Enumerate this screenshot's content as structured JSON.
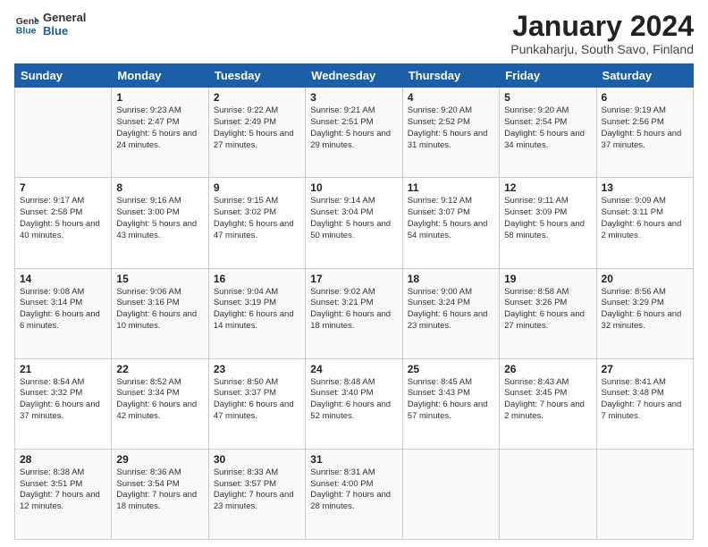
{
  "logo": {
    "line1": "General",
    "line2": "Blue"
  },
  "title": "January 2024",
  "subtitle": "Punkaharju, South Savo, Finland",
  "weekdays": [
    "Sunday",
    "Monday",
    "Tuesday",
    "Wednesday",
    "Thursday",
    "Friday",
    "Saturday"
  ],
  "weeks": [
    [
      {
        "day": "",
        "sunrise": "",
        "sunset": "",
        "daylight": ""
      },
      {
        "day": "1",
        "sunrise": "Sunrise: 9:23 AM",
        "sunset": "Sunset: 2:47 PM",
        "daylight": "Daylight: 5 hours and 24 minutes."
      },
      {
        "day": "2",
        "sunrise": "Sunrise: 9:22 AM",
        "sunset": "Sunset: 2:49 PM",
        "daylight": "Daylight: 5 hours and 27 minutes."
      },
      {
        "day": "3",
        "sunrise": "Sunrise: 9:21 AM",
        "sunset": "Sunset: 2:51 PM",
        "daylight": "Daylight: 5 hours and 29 minutes."
      },
      {
        "day": "4",
        "sunrise": "Sunrise: 9:20 AM",
        "sunset": "Sunset: 2:52 PM",
        "daylight": "Daylight: 5 hours and 31 minutes."
      },
      {
        "day": "5",
        "sunrise": "Sunrise: 9:20 AM",
        "sunset": "Sunset: 2:54 PM",
        "daylight": "Daylight: 5 hours and 34 minutes."
      },
      {
        "day": "6",
        "sunrise": "Sunrise: 9:19 AM",
        "sunset": "Sunset: 2:56 PM",
        "daylight": "Daylight: 5 hours and 37 minutes."
      }
    ],
    [
      {
        "day": "7",
        "sunrise": "Sunrise: 9:17 AM",
        "sunset": "Sunset: 2:58 PM",
        "daylight": "Daylight: 5 hours and 40 minutes."
      },
      {
        "day": "8",
        "sunrise": "Sunrise: 9:16 AM",
        "sunset": "Sunset: 3:00 PM",
        "daylight": "Daylight: 5 hours and 43 minutes."
      },
      {
        "day": "9",
        "sunrise": "Sunrise: 9:15 AM",
        "sunset": "Sunset: 3:02 PM",
        "daylight": "Daylight: 5 hours and 47 minutes."
      },
      {
        "day": "10",
        "sunrise": "Sunrise: 9:14 AM",
        "sunset": "Sunset: 3:04 PM",
        "daylight": "Daylight: 5 hours and 50 minutes."
      },
      {
        "day": "11",
        "sunrise": "Sunrise: 9:12 AM",
        "sunset": "Sunset: 3:07 PM",
        "daylight": "Daylight: 5 hours and 54 minutes."
      },
      {
        "day": "12",
        "sunrise": "Sunrise: 9:11 AM",
        "sunset": "Sunset: 3:09 PM",
        "daylight": "Daylight: 5 hours and 58 minutes."
      },
      {
        "day": "13",
        "sunrise": "Sunrise: 9:09 AM",
        "sunset": "Sunset: 3:11 PM",
        "daylight": "Daylight: 6 hours and 2 minutes."
      }
    ],
    [
      {
        "day": "14",
        "sunrise": "Sunrise: 9:08 AM",
        "sunset": "Sunset: 3:14 PM",
        "daylight": "Daylight: 6 hours and 6 minutes."
      },
      {
        "day": "15",
        "sunrise": "Sunrise: 9:06 AM",
        "sunset": "Sunset: 3:16 PM",
        "daylight": "Daylight: 6 hours and 10 minutes."
      },
      {
        "day": "16",
        "sunrise": "Sunrise: 9:04 AM",
        "sunset": "Sunset: 3:19 PM",
        "daylight": "Daylight: 6 hours and 14 minutes."
      },
      {
        "day": "17",
        "sunrise": "Sunrise: 9:02 AM",
        "sunset": "Sunset: 3:21 PM",
        "daylight": "Daylight: 6 hours and 18 minutes."
      },
      {
        "day": "18",
        "sunrise": "Sunrise: 9:00 AM",
        "sunset": "Sunset: 3:24 PM",
        "daylight": "Daylight: 6 hours and 23 minutes."
      },
      {
        "day": "19",
        "sunrise": "Sunrise: 8:58 AM",
        "sunset": "Sunset: 3:26 PM",
        "daylight": "Daylight: 6 hours and 27 minutes."
      },
      {
        "day": "20",
        "sunrise": "Sunrise: 8:56 AM",
        "sunset": "Sunset: 3:29 PM",
        "daylight": "Daylight: 6 hours and 32 minutes."
      }
    ],
    [
      {
        "day": "21",
        "sunrise": "Sunrise: 8:54 AM",
        "sunset": "Sunset: 3:32 PM",
        "daylight": "Daylight: 6 hours and 37 minutes."
      },
      {
        "day": "22",
        "sunrise": "Sunrise: 8:52 AM",
        "sunset": "Sunset: 3:34 PM",
        "daylight": "Daylight: 6 hours and 42 minutes."
      },
      {
        "day": "23",
        "sunrise": "Sunrise: 8:50 AM",
        "sunset": "Sunset: 3:37 PM",
        "daylight": "Daylight: 6 hours and 47 minutes."
      },
      {
        "day": "24",
        "sunrise": "Sunrise: 8:48 AM",
        "sunset": "Sunset: 3:40 PM",
        "daylight": "Daylight: 6 hours and 52 minutes."
      },
      {
        "day": "25",
        "sunrise": "Sunrise: 8:45 AM",
        "sunset": "Sunset: 3:43 PM",
        "daylight": "Daylight: 6 hours and 57 minutes."
      },
      {
        "day": "26",
        "sunrise": "Sunrise: 8:43 AM",
        "sunset": "Sunset: 3:45 PM",
        "daylight": "Daylight: 7 hours and 2 minutes."
      },
      {
        "day": "27",
        "sunrise": "Sunrise: 8:41 AM",
        "sunset": "Sunset: 3:48 PM",
        "daylight": "Daylight: 7 hours and 7 minutes."
      }
    ],
    [
      {
        "day": "28",
        "sunrise": "Sunrise: 8:38 AM",
        "sunset": "Sunset: 3:51 PM",
        "daylight": "Daylight: 7 hours and 12 minutes."
      },
      {
        "day": "29",
        "sunrise": "Sunrise: 8:36 AM",
        "sunset": "Sunset: 3:54 PM",
        "daylight": "Daylight: 7 hours and 18 minutes."
      },
      {
        "day": "30",
        "sunrise": "Sunrise: 8:33 AM",
        "sunset": "Sunset: 3:57 PM",
        "daylight": "Daylight: 7 hours and 23 minutes."
      },
      {
        "day": "31",
        "sunrise": "Sunrise: 8:31 AM",
        "sunset": "Sunset: 4:00 PM",
        "daylight": "Daylight: 7 hours and 28 minutes."
      },
      {
        "day": "",
        "sunrise": "",
        "sunset": "",
        "daylight": ""
      },
      {
        "day": "",
        "sunrise": "",
        "sunset": "",
        "daylight": ""
      },
      {
        "day": "",
        "sunrise": "",
        "sunset": "",
        "daylight": ""
      }
    ]
  ]
}
